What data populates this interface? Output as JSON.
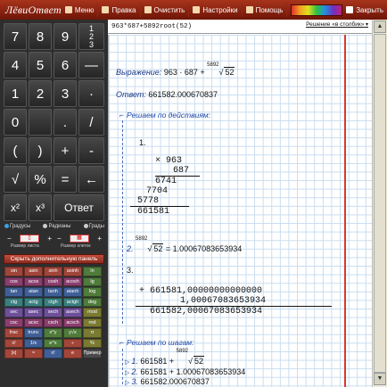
{
  "toolbar": {
    "logo": "ЛёвиОтвет",
    "menu": "Меню",
    "edit": "Правка",
    "clear": "Очистить",
    "settings": "Настройки",
    "help": "Помощь",
    "close": "Закрыть"
  },
  "keypad": {
    "keys": [
      "7",
      "8",
      "9",
      "",
      "4",
      "5",
      "6",
      "—",
      "1",
      "2",
      "3",
      "·",
      "0",
      "",
      ".",
      "/",
      "(",
      ")",
      "+",
      "-",
      "√",
      "%",
      "=",
      "←",
      "x²",
      "x³",
      "Ответ"
    ],
    "frac_top": "1",
    "frac_mid": "2",
    "frac_bot": "3",
    "mode_deg": "Градусы",
    "mode_rad": "Радианы",
    "mode_grad": "Грады",
    "sheet_label": "Размер листа",
    "cell_label": "Размер клеток",
    "hide_panel": "Скрыть дополнительную панель",
    "func_keys": [
      "sin",
      "asin",
      "sinh",
      "asinh",
      "ln",
      "cos",
      "acos",
      "cosh",
      "acosh",
      "lg",
      "tan",
      "atan",
      "tanh",
      "atanh",
      "log",
      "ctg",
      "actg",
      "ctgh",
      "actgh",
      "deg",
      "sec",
      "asec",
      "sech",
      "asech",
      "mod",
      "csc",
      "acsc",
      "csch",
      "acsch",
      "rnd",
      "frac",
      "trunc",
      "x^y",
      "y√x",
      "π",
      "x!",
      "1/x",
      "e^x",
      "÷",
      "%",
      "|x|",
      "≈",
      "x!",
      "e",
      "Пример"
    ]
  },
  "work": {
    "input": "963*687+5892root(52)",
    "method": "Решение «в столбик»",
    "expr_label": "Выражение:",
    "expr_value": "963 · 687 +",
    "root_index": "5892",
    "root_arg": "52",
    "answer_label": "Ответ:",
    "answer_value": "661582.000670837",
    "by_action": "Решаем по действиям:",
    "step1": "1.",
    "mul_a": "963",
    "mul_b": "687",
    "row1": "6741",
    "row2": "7704",
    "row3": "5778",
    "mul_result": "661581",
    "step2": "2.",
    "step2_result": "= 1.00067083653934",
    "step3": "3.",
    "add_a": "661581,00000000000000",
    "add_b": "1,00067083653934",
    "add_result": "661582,00067083653934",
    "by_step": "Решаем по шагам:",
    "s1_num": "1.",
    "s1_text": "661581 +",
    "s2_num": "2.",
    "s2_text": "661581 + 1.00067083653934",
    "s3_num": "3.",
    "s3_text": "661582.000670837"
  },
  "colors": {
    "toolbar": "#8e2a15",
    "keypad": "#2e2e2e",
    "margin_line": "#d43b2c",
    "grid": "#c8dcef",
    "link_blue": "#1c47a8"
  }
}
